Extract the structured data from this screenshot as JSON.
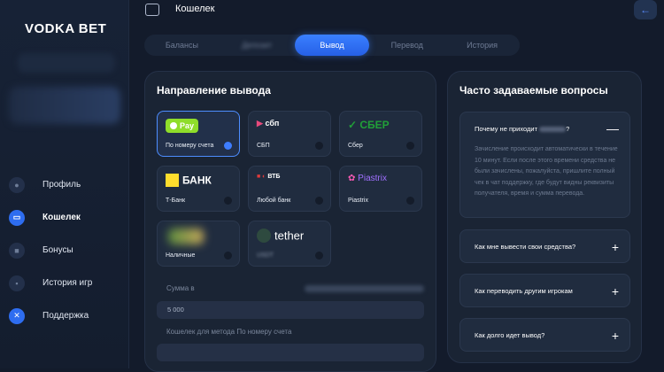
{
  "brand": {
    "logo_text": "VODKA BET"
  },
  "sidebar": {
    "items": [
      {
        "label": "Профиль",
        "icon": "user-icon"
      },
      {
        "label": "Кошелек",
        "icon": "wallet-icon"
      },
      {
        "label": "Бонусы",
        "icon": "gift-icon"
      },
      {
        "label": "История игр",
        "icon": "history-icon"
      },
      {
        "label": "Поддержка",
        "icon": "support-icon"
      }
    ]
  },
  "header": {
    "title": "Кошелек"
  },
  "tabs": [
    {
      "label": "Балансы"
    },
    {
      "label": "Депозит"
    },
    {
      "label": "Вывод",
      "active": true
    },
    {
      "label": "Перевод"
    },
    {
      "label": "История"
    }
  ],
  "withdraw": {
    "title": "Направление вывода",
    "methods": [
      {
        "name": "По номеру счета",
        "logo": "Pay",
        "selected": true
      },
      {
        "name": "СБП",
        "logo": "сбп"
      },
      {
        "name": "Сбер",
        "logo": "СБЕР"
      },
      {
        "name": "Т-Банк",
        "logo": "БАНК"
      },
      {
        "name": "Любой банк",
        "logo": "ВТБ"
      },
      {
        "name": "Piastrix",
        "logo": "Piastrix"
      },
      {
        "name": "Наличные",
        "logo": ""
      },
      {
        "name": "USDT",
        "logo": "tether"
      }
    ],
    "amount_label": "Сумма в",
    "amount_value": "5 000",
    "wallet_label": "Кошелек для метода По номеру счета"
  },
  "faq": {
    "title": "Часто задаваемые вопросы",
    "items": [
      {
        "q": "Почему не приходит",
        "q_tail": "?",
        "sign": "—",
        "answer": "Зачисление происходит автоматически в течение 10 минут. Если после этого времени средства не были зачислены, пожалуйста, пришлите полный чек в чат поддержку, где будут видны реквизиты получателя, время и сумма перевода."
      },
      {
        "q": "Как мне вывести свои средства?",
        "sign": "+"
      },
      {
        "q": "Как переводить другим игрокам",
        "sign": "+"
      },
      {
        "q": "Как долго идет вывод?",
        "sign": "+"
      }
    ]
  },
  "colors": {
    "accent": "#2e6df0",
    "bg": "#131b2b",
    "panel": "#1a2434"
  }
}
